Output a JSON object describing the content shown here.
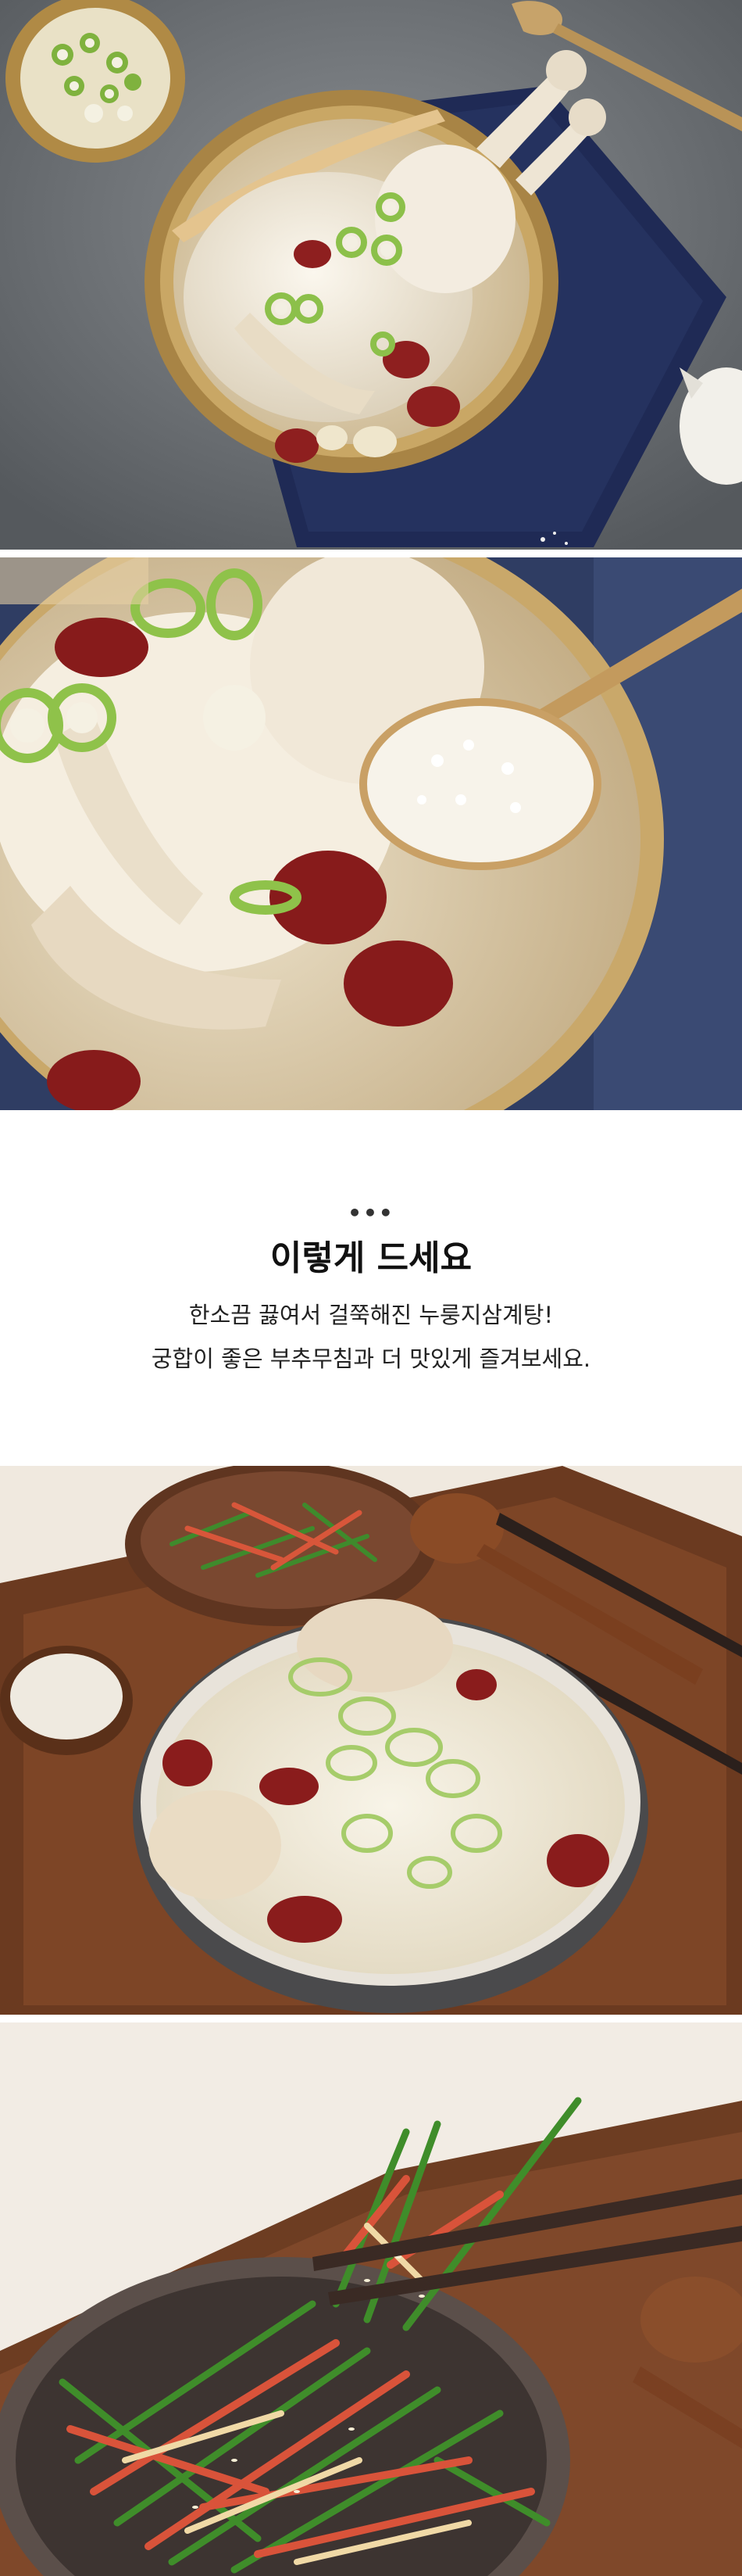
{
  "section": {
    "dots": "•••",
    "heading": "이렇게 드세요",
    "line1": "한소끔 끓여서 걸쭉해진 누룽지삼계탕!",
    "line2": "궁합이 좋은 부추무침과 더 맛있게 즐겨보세요."
  },
  "photos": [
    {
      "name": "samgyetang-top-view",
      "icon": "food-photo"
    },
    {
      "name": "samgyetang-spoon-closeup",
      "icon": "food-photo"
    },
    {
      "name": "nurungji-samgyetang-tray",
      "icon": "food-photo"
    },
    {
      "name": "buchu-muchim-chopsticks",
      "icon": "food-photo"
    }
  ],
  "colors": {
    "background": "#ffffff",
    "heading": "#111111",
    "body_text": "#222222"
  }
}
